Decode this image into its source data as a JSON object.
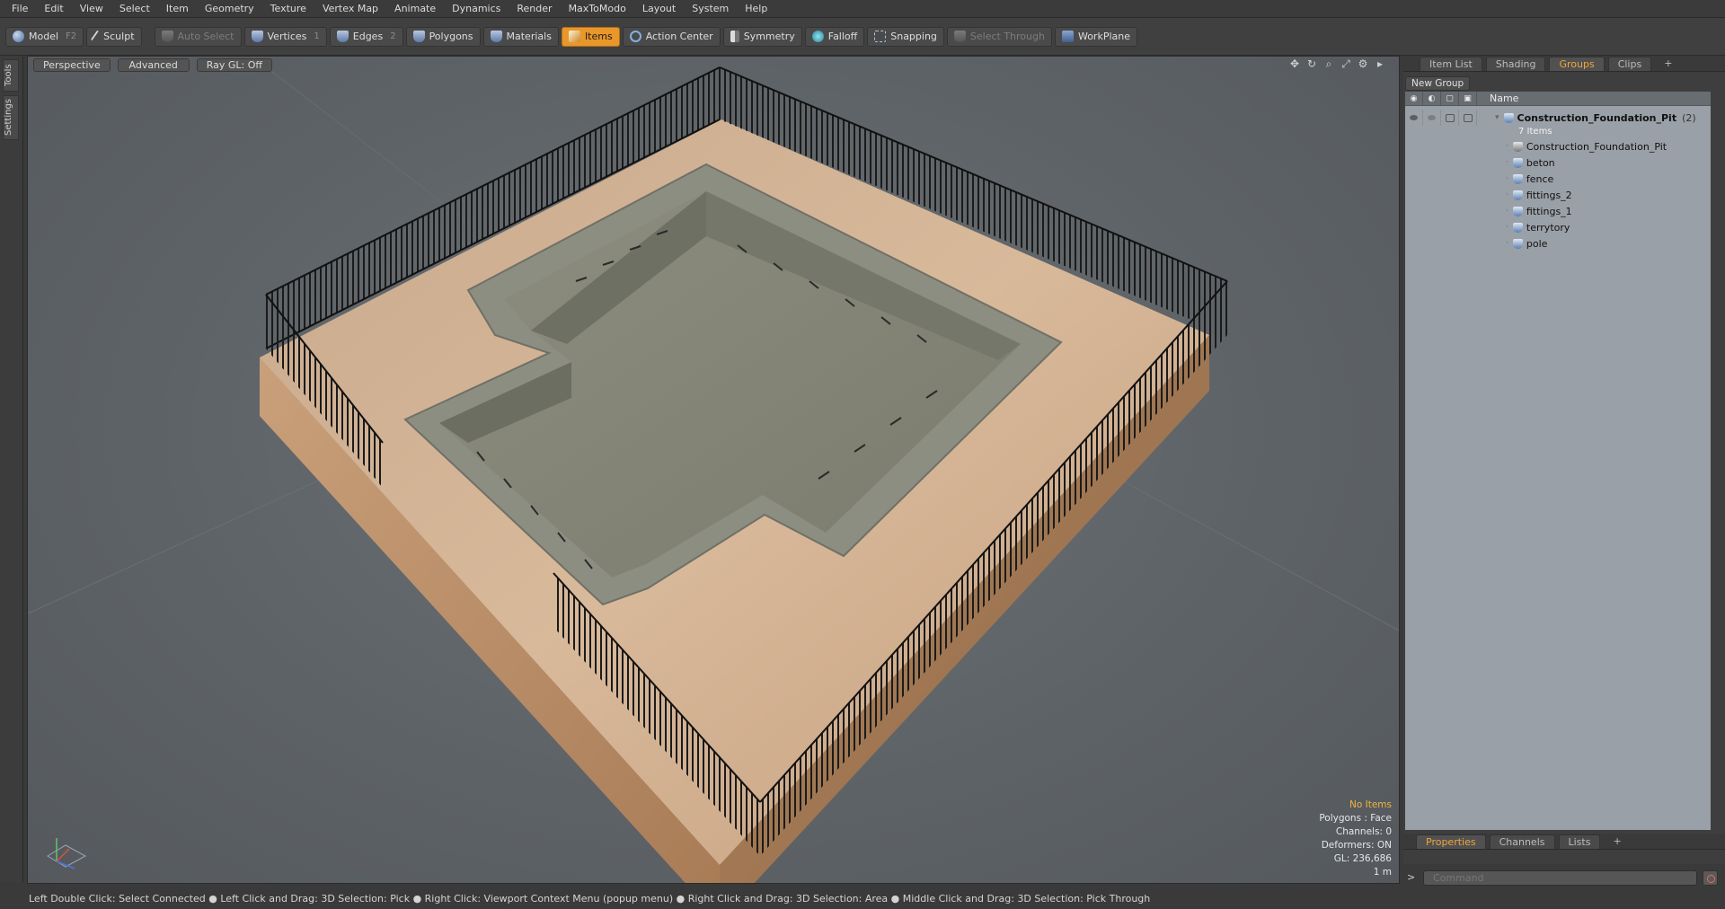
{
  "menu": [
    "File",
    "Edit",
    "View",
    "Select",
    "Item",
    "Geometry",
    "Texture",
    "Vertex Map",
    "Animate",
    "Dynamics",
    "Render",
    "MaxToModo",
    "Layout",
    "System",
    "Help"
  ],
  "toolbar": {
    "model": "Model",
    "model_key": "F2",
    "sculpt": "Sculpt",
    "auto_select": "Auto Select",
    "vertices": "Vertices",
    "vertices_key": "1",
    "edges": "Edges",
    "edges_key": "2",
    "polygons": "Polygons",
    "materials": "Materials",
    "items": "Items",
    "action_center": "Action Center",
    "symmetry": "Symmetry",
    "falloff": "Falloff",
    "snapping": "Snapping",
    "select_through": "Select Through",
    "workplane": "WorkPlane",
    "active_color": "#e9972a"
  },
  "left_tabs": [
    "Tools",
    "Settings"
  ],
  "viewport": {
    "perspective": "Perspective",
    "advanced": "Advanced",
    "raygl": "Ray GL: Off",
    "info": {
      "no_items": "No Items",
      "polygons": "Polygons : Face",
      "channels": "Channels: 0",
      "deformers": "Deformers: ON",
      "gl": "GL: 236,686",
      "scale": "1 m"
    }
  },
  "right_panel": {
    "tabs": [
      "Item List",
      "Shading",
      "Groups",
      "Clips",
      "+"
    ],
    "active_tab": "Groups",
    "new_group": "New Group",
    "name_header": "Name",
    "group_name": "Construction_Foundation_Pit",
    "group_count": "(2)",
    "group_items": "7 Items",
    "items": [
      "Construction_Foundation_Pit",
      "beton",
      "fence",
      "fittings_2",
      "fittings_1",
      "terrytory",
      "pole"
    ],
    "bottom_tabs": [
      "Properties",
      "Channels",
      "Lists",
      "+"
    ],
    "command_placeholder": "Command"
  },
  "status": "Left Double Click: Select Connected ● Left Click and Drag: 3D Selection: Pick ● Right Click: Viewport Context Menu (popup menu) ● Right Click and Drag: 3D Selection: Area ● Middle Click and Drag: 3D Selection: Pick Through"
}
